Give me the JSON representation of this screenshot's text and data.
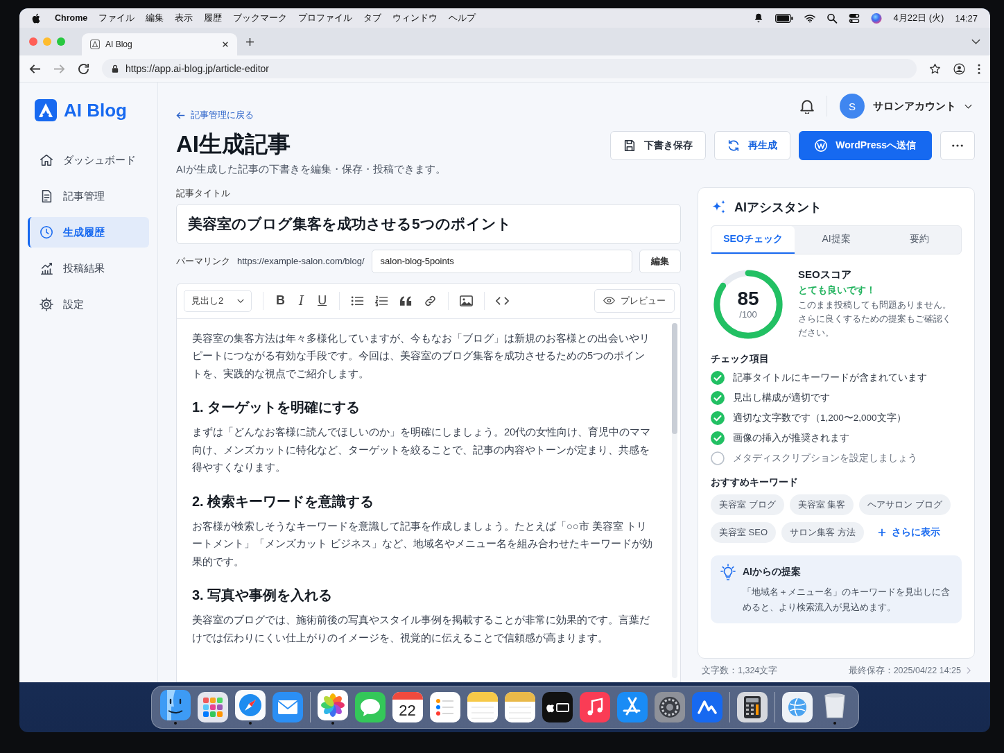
{
  "menu_bar": {
    "app_name": "Chrome",
    "menus": [
      "ファイル",
      "編集",
      "表示",
      "履歴",
      "ブックマーク",
      "プロファイル",
      "タブ",
      "ウィンドウ",
      "ヘルプ"
    ],
    "date": "4月22日 (火)",
    "time": "14:27"
  },
  "browser": {
    "tab_title": "AI Blog",
    "url": "https://app.ai-blog.jp/article-editor"
  },
  "sidebar": {
    "logo": "AI Blog",
    "items": [
      {
        "label": "ダッシュボード",
        "selected": false
      },
      {
        "label": "記事管理",
        "selected": false
      },
      {
        "label": "生成履歴",
        "selected": true
      },
      {
        "label": "投稿結果",
        "selected": false
      },
      {
        "label": "設定",
        "selected": false
      }
    ]
  },
  "account": {
    "initial": "S",
    "name": "サロンアカウント"
  },
  "header": {
    "back_link": "記事管理に戻る",
    "title": "AI生成記事",
    "subtitle": "AIが生成した記事の下書きを編集・保存・投稿できます。",
    "actions": [
      {
        "kind": "secondary",
        "label": "下書き保存"
      },
      {
        "kind": "accent",
        "label": "再生成"
      },
      {
        "kind": "primary",
        "label": "WordPressへ送信"
      },
      {
        "kind": "more"
      }
    ]
  },
  "title_field": {
    "label": "記事タイトル",
    "value": "美容室のブログ集客を成功させる5つのポイント"
  },
  "permalink": {
    "label": "パーマリンク",
    "base": "https://example-salon.com/blog/",
    "slug": "salon-blog-5points",
    "button": "編集"
  },
  "editor": {
    "block_style": "見出し2",
    "format_buttons": [
      "B",
      "I",
      "U"
    ],
    "preview": "プレビュー",
    "content": [
      {
        "kind": "paragraph",
        "text": "美容室の集客方法は年々多様化していますが、今もなお「ブログ」は新規のお客様との出会いやリピートにつながる有効な手段です。今回は、美容室のブログ集客を成功させるための5つのポイントを、実践的な視点でご紹介します。"
      },
      {
        "kind": "heading",
        "text": "1. ターゲットを明確にする"
      },
      {
        "kind": "paragraph",
        "text": "まずは「どんなお客様に読んでほしいのか」を明確にしましょう。20代の女性向け、育児中のママ向け、メンズカットに特化など、ターゲットを絞ることで、記事の内容やトーンが定まり、共感を得やすくなります。"
      },
      {
        "kind": "heading",
        "text": "2. 検索キーワードを意識する"
      },
      {
        "kind": "paragraph",
        "text": "お客様が検索しそうなキーワードを意識して記事を作成しましょう。たとえば「○○市 美容室 トリートメント」「メンズカット ビジネス」など、地域名やメニュー名を組み合わせたキーワードが効果的です。"
      },
      {
        "kind": "heading",
        "text": "3. 写真や事例を入れる"
      },
      {
        "kind": "paragraph",
        "text": "美容室のブログでは、施術前後の写真やスタイル事例を掲載することが非常に効果的です。言葉だけでは伝わりにくい仕上がりのイメージを、視覚的に伝えることで信頼感が高まります。"
      }
    ]
  },
  "assistant": {
    "title": "AIアシスタント",
    "tabs": [
      {
        "label": "SEOチェック",
        "selected": true
      },
      {
        "label": "AI提案",
        "selected": false
      },
      {
        "label": "要約",
        "selected": false
      }
    ],
    "score": {
      "value": "85",
      "max": "/100",
      "level": 0.85,
      "title": "SEOスコア",
      "verdict": "とても良いです！",
      "note": "このまま投稿しても問題ありません。さらに良くするための提案もご確認ください。"
    },
    "checks_title": "チェック項目",
    "checks": [
      {
        "label": "記事タイトルにキーワードが含まれています",
        "checked": true
      },
      {
        "label": "見出し構成が適切です",
        "checked": true
      },
      {
        "label": "適切な文字数です（1,200〜2,000文字）",
        "checked": true
      },
      {
        "label": "画像の挿入が推奨されます",
        "checked": true
      },
      {
        "label": "メタディスクリプションを設定しましょう",
        "checked": false
      }
    ],
    "keywords_title": "おすすめキーワード",
    "keywords": [
      "美容室 ブログ",
      "美容室 集客",
      "ヘアサロン ブログ",
      "美容室 SEO",
      "サロン集客 方法"
    ],
    "more_keywords": "さらに表示",
    "tip": {
      "title": "AIからの提案",
      "text": "「地域名＋メニュー名」のキーワードを見出しに含めると、より検索流入が見込めます。"
    }
  },
  "status_bar": {
    "char_count": "文字数：1,324文字",
    "last_saved": "最終保存：2025/04/22 14:25"
  },
  "dock": {
    "calendar_day": "22"
  }
}
